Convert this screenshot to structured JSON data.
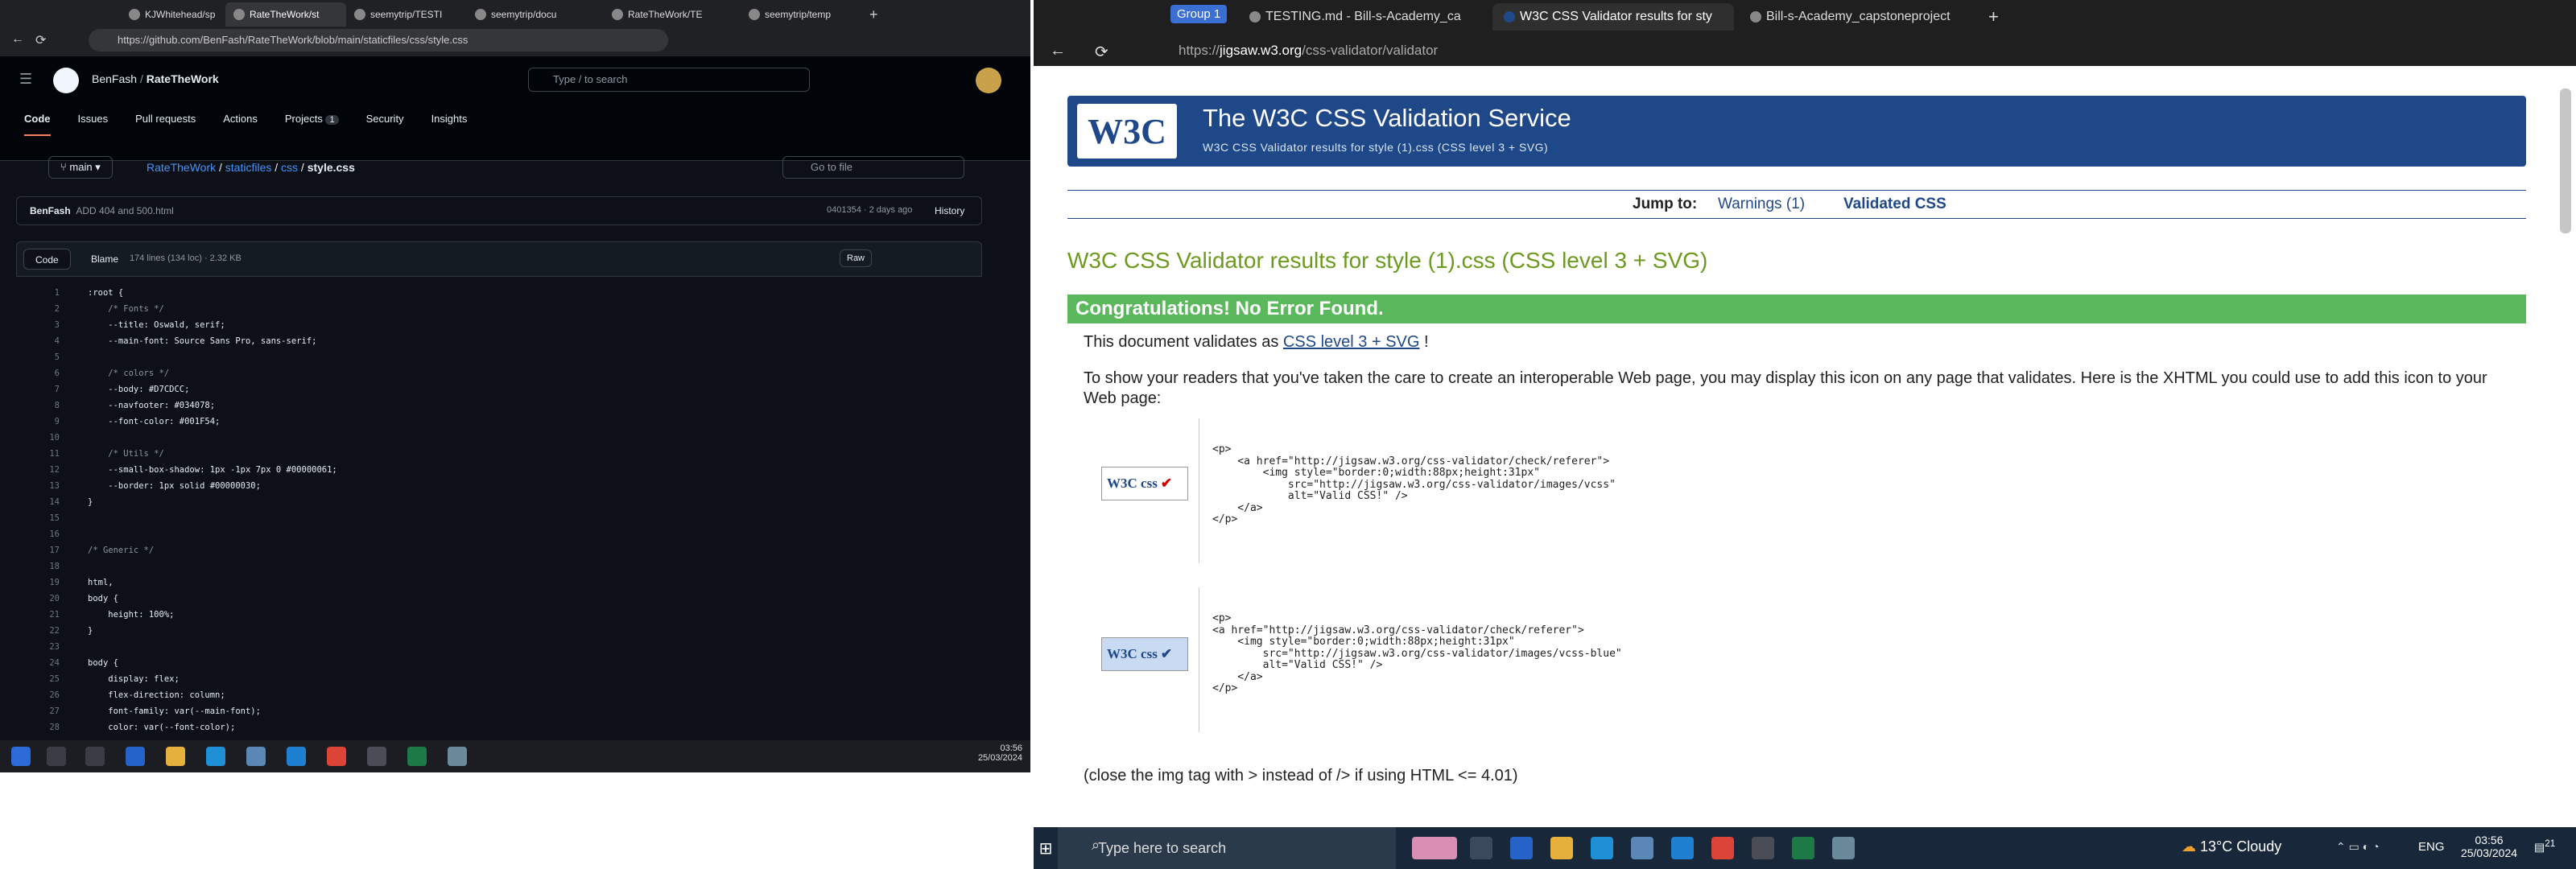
{
  "left": {
    "tabs": [
      "KJWhitehead/sp",
      "RateTheWork/st",
      "seemytrip/TESTI",
      "seemytrip/docu",
      "RateTheWork/TE",
      "seemytrip/temp"
    ],
    "url": "https://github.com/BenFash/RateTheWork/blob/main/staticfiles/css/style.css",
    "owner": "BenFash",
    "repo": "RateTheWork",
    "search_placeholder": "Type / to search",
    "nav": [
      "Code",
      "Issues",
      "Pull requests",
      "Actions",
      "Projects",
      "Security",
      "Insights"
    ],
    "projects_count": "1",
    "branch": "main",
    "crumbs": [
      "RateTheWork",
      "staticfiles",
      "css",
      "style.css"
    ],
    "goto_placeholder": "Go to file",
    "commit_author": "BenFash",
    "commit_msg": "ADD 404 and 500.html",
    "commit_meta": "0401354 · 2 days ago",
    "history": "History",
    "code_tab": "Code",
    "blame_tab": "Blame",
    "file_meta": "174 lines (134 loc) · 2.32 KB",
    "raw": "Raw",
    "code_lines": [
      ":root {",
      "    /* Fonts */",
      "    --title: Oswald, serif;",
      "    --main-font: Source Sans Pro, sans-serif;",
      "",
      "    /* colors */",
      "    --body: #D7CDCC;",
      "    --navfooter: #034078;",
      "    --font-color: #001F54;",
      "",
      "    /* Utils */",
      "    --small-box-shadow: 1px -1px 7px 0 #00000061;",
      "    --border: 1px solid #00000030;",
      "}",
      "",
      "",
      "/* Generic */",
      "",
      "html,",
      "body {",
      "    height: 100%;",
      "}",
      "",
      "body {",
      "    display: flex;",
      "    flex-direction: column;",
      "    font-family: var(--main-font);",
      "    color: var(--font-color);"
    ],
    "clock_time": "03:56",
    "clock_date": "25/03/2024"
  },
  "right": {
    "group_label": "Group 1",
    "tabs": [
      "TESTING.md - Bill-s-Academy_ca",
      "W3C CSS Validator results for sty",
      "Bill-s-Academy_capstoneproject"
    ],
    "url_host": "jigsaw.w3.org",
    "url_prefix": "https://",
    "url_path": "/css-validator/validator",
    "service_title": "The W3C CSS Validation Service",
    "service_subtitle": "W3C CSS Validator results for style (1).css (CSS level 3 + SVG)",
    "jump_label": "Jump to:",
    "jump_warnings": "Warnings (1)",
    "jump_validated": "Validated CSS",
    "results_heading": "W3C CSS Validator results for style (1).css (CSS level 3 + SVG)",
    "congrats": "Congratulations! No Error Found.",
    "validates_pre": "This document validates as ",
    "validates_link": "CSS level 3 + SVG",
    "validates_post": " !",
    "show_readers": "To show your readers that you've taken the care to create an interoperable Web page, you may display this icon on any page that validates. Here is the XHTML you could use to add this icon to your Web page:",
    "snippet1": "<p>\n    <a href=\"http://jigsaw.w3.org/css-validator/check/referer\">\n        <img style=\"border:0;width:88px;height:31px\"\n            src=\"http://jigsaw.w3.org/css-validator/images/vcss\"\n            alt=\"Valid CSS!\" />\n    </a>\n</p>",
    "snippet2": "<p>\n<a href=\"http://jigsaw.w3.org/css-validator/check/referer\">\n    <img style=\"border:0;width:88px;height:31px\"\n        src=\"http://jigsaw.w3.org/css-validator/images/vcss-blue\"\n        alt=\"Valid CSS!\" />\n    </a>\n</p>",
    "badge_text": "W3C css",
    "close_tag_note": "(close the img tag with > instead of /> if using HTML <= 4.01)",
    "taskbar_search": "Type here to search",
    "weather": "13°C  Cloudy",
    "lang": "ENG",
    "clock_time": "03:56",
    "clock_date": "25/03/2024",
    "notif_count": "21"
  }
}
